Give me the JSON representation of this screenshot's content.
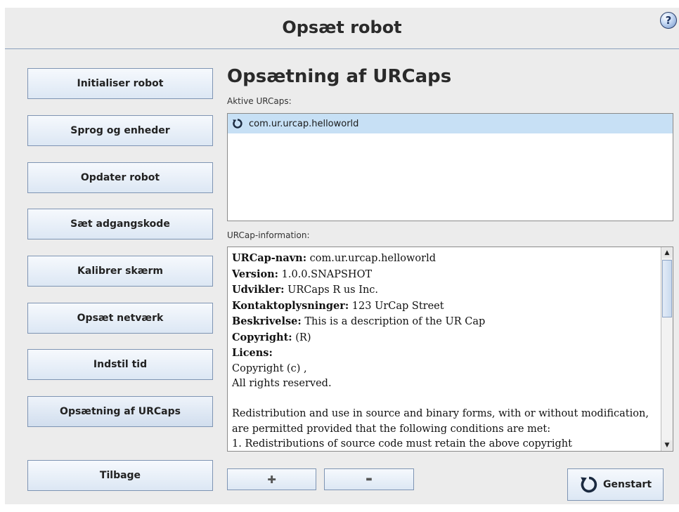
{
  "header": {
    "title": "Opsæt robot",
    "help_glyph": "?"
  },
  "nav": {
    "items": [
      {
        "label": "Initialiser robot"
      },
      {
        "label": "Sprog og enheder"
      },
      {
        "label": "Opdater robot"
      },
      {
        "label": "Sæt adgangskode"
      },
      {
        "label": "Kalibrer skærm"
      },
      {
        "label": "Opsæt netværk"
      },
      {
        "label": "Indstil tid"
      },
      {
        "label": "Opsætning af URCaps"
      }
    ],
    "back_label": "Tilbage"
  },
  "main": {
    "title": "Opsætning af URCaps",
    "active_label": "Aktive URCaps:",
    "active_items": [
      {
        "name": "com.ur.urcap.helloworld",
        "icon": "refresh-icon"
      }
    ],
    "info_label": "URCap-information:",
    "info": {
      "name_key": "URCap-navn:",
      "name_val": " com.ur.urcap.helloworld",
      "version_key": "Version:",
      "version_val": " 1.0.0.SNAPSHOT",
      "dev_key": "Udvikler:",
      "dev_val": " URCaps R us Inc.",
      "contact_key": "Kontaktoplysninger:",
      "contact_val": " 123 UrCap Street",
      "desc_key": "Beskrivelse:",
      "desc_val": " This is a description of the UR Cap",
      "copy_key": "Copyright:",
      "copy_val": " (R)",
      "license_key": "Licens:",
      "license_line1": "Copyright (c) ,",
      "license_line2": "All rights reserved.",
      "license_para": "Redistribution and use in source and binary forms, with or without modification, are permitted provided that the following conditions are met:",
      "license_cut": "1. Redistributions of source code must retain the above copyright"
    },
    "add_glyph": "✚",
    "remove_glyph": "▬",
    "restart_label": "Genstart"
  }
}
